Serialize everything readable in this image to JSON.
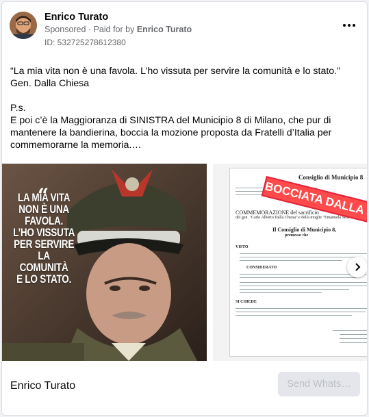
{
  "post": {
    "author": "Enrico Turato",
    "sponsored_label": "Sponsored",
    "paid_for_prefix": "Paid for by",
    "paid_for_by": "Enrico Turato",
    "ad_id": "ID: 532725278612380",
    "text_line1": "“La mia vita non è una favola. L’ho vissuta per servire la comunità e lo stato.”",
    "text_line2": "Gen. Dalla Chiesa",
    "text_line3": "P.s.",
    "text_line4": "E poi c’è la Maggioranza di SINISTRA del Municipio 8 di Milano, che pur di mantenere la bandierina, boccia la mozione proposta da Fratelli d’Italia per commemorarne la memoria.…"
  },
  "carousel": {
    "slide1_quote_mark": "“",
    "slide1_quote": [
      "LA MIA VITA",
      "NON È UNA",
      "FAVOLA.",
      "L’HO VISSUTA",
      "PER SERVIRE",
      "LA COMUNITÀ",
      "E LO STATO."
    ],
    "slide2_stamp": "BOCCIATA DALLA SINI",
    "slide2_heading": "Consiglio di Municipio 8",
    "slide2_commemoration": "COMMEMORAZIONE del sacrificio",
    "slide2_subtitle": "del gen. \"Carlo Alberto Dalla Chiesa\" e della moglie \"Emanuela Setti C",
    "slide2_council": "Il Consiglio di Municipio 8,",
    "slide2_premesso": "premesso che",
    "slide2_visto": "VISTO",
    "slide2_considerato": "CONSIDERATO",
    "slide2_si_chiede": "SI CHIEDE"
  },
  "footer": {
    "page_name": "Enrico Turato",
    "cta_label": "Send Whats…"
  },
  "colors": {
    "stamp_red": "#e2233a",
    "meta_gray": "#65676b",
    "cta_bg": "#e4e6eb"
  },
  "icons": {
    "more": "more-dots-icon",
    "next": "chevron-right-icon"
  }
}
